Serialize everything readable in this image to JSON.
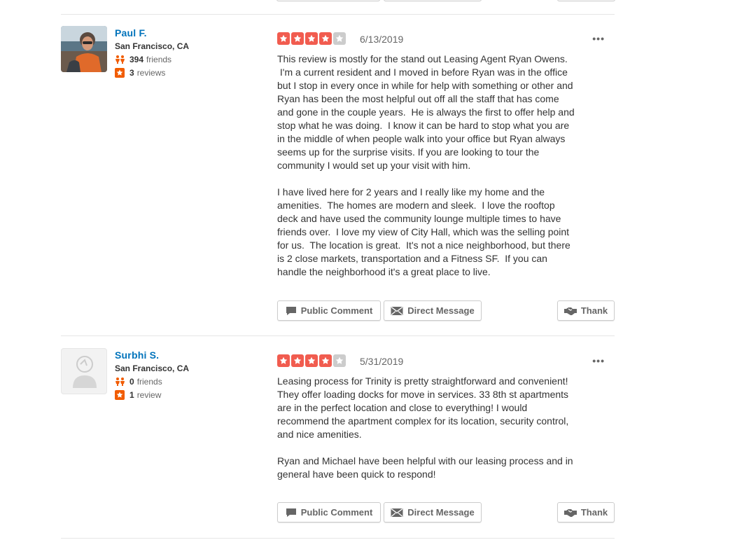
{
  "colors": {
    "star_on": "#f15c4f",
    "star_off": "#cccccc",
    "name_link": "#0073bb"
  },
  "reviews": [
    {
      "user": {
        "name": "Paul F.",
        "location": "San Francisco, CA",
        "friends_count": "394",
        "friends_label": "friends",
        "reviews_count": "3",
        "reviews_label": "reviews",
        "avatar": "user-photo"
      },
      "rating": 4,
      "rating_max": 5,
      "date": "6/13/2019",
      "more_label": "•••",
      "paragraphs": [
        "This review is mostly for the stand out Leasing Agent Ryan Owens.\n I'm a current resident and I moved in before Ryan was in the office\nbut I stop in every once in while for help with something or other and\nRyan has been the most helpful out off all the staff that has come\nand gone in the couple years.  He is always the first to offer help and\nstop what he was doing.  I know it can be hard to stop what you are\nin the middle of when people walk into your office but Ryan always\nseems up for the surprise visits. If you are looking to tour the\ncommunity I would set up your visit with him.",
        "I have lived here for 2 years and I really like my home and the\namenities.  The homes are modern and sleek.  I love the rooftop\ndeck and have used the community lounge multiple times to have\nfriends over.  I love my view of City Hall, which was the selling point\nfor us.  The location is great.  It's not a nice neighborhood, but there\nis 2 close markets, transportation and a Fitness SF.  If you can\nhandle the neighborhood it's a great place to live."
      ],
      "actions": {
        "public_comment": "Public Comment",
        "direct_message": "Direct Message",
        "thank": "Thank"
      }
    },
    {
      "user": {
        "name": "Surbhi S.",
        "location": "San Francisco, CA",
        "friends_count": "0",
        "friends_label": "friends",
        "reviews_count": "1",
        "reviews_label": "review",
        "avatar": "default-avatar"
      },
      "rating": 4,
      "rating_max": 5,
      "date": "5/31/2019",
      "more_label": "•••",
      "paragraphs": [
        "Leasing process for Trinity is pretty straightforward and convenient!\nThey offer loading docks for move in services. 33 8th st apartments\nare in the perfect location and close to everything! I would\nrecommend the apartment complex for its location, security control,\nand nice amenities.",
        "Ryan and Michael have been helpful with our leasing process and in\ngeneral have been quick to respond!"
      ],
      "actions": {
        "public_comment": "Public Comment",
        "direct_message": "Direct Message",
        "thank": "Thank"
      }
    }
  ]
}
